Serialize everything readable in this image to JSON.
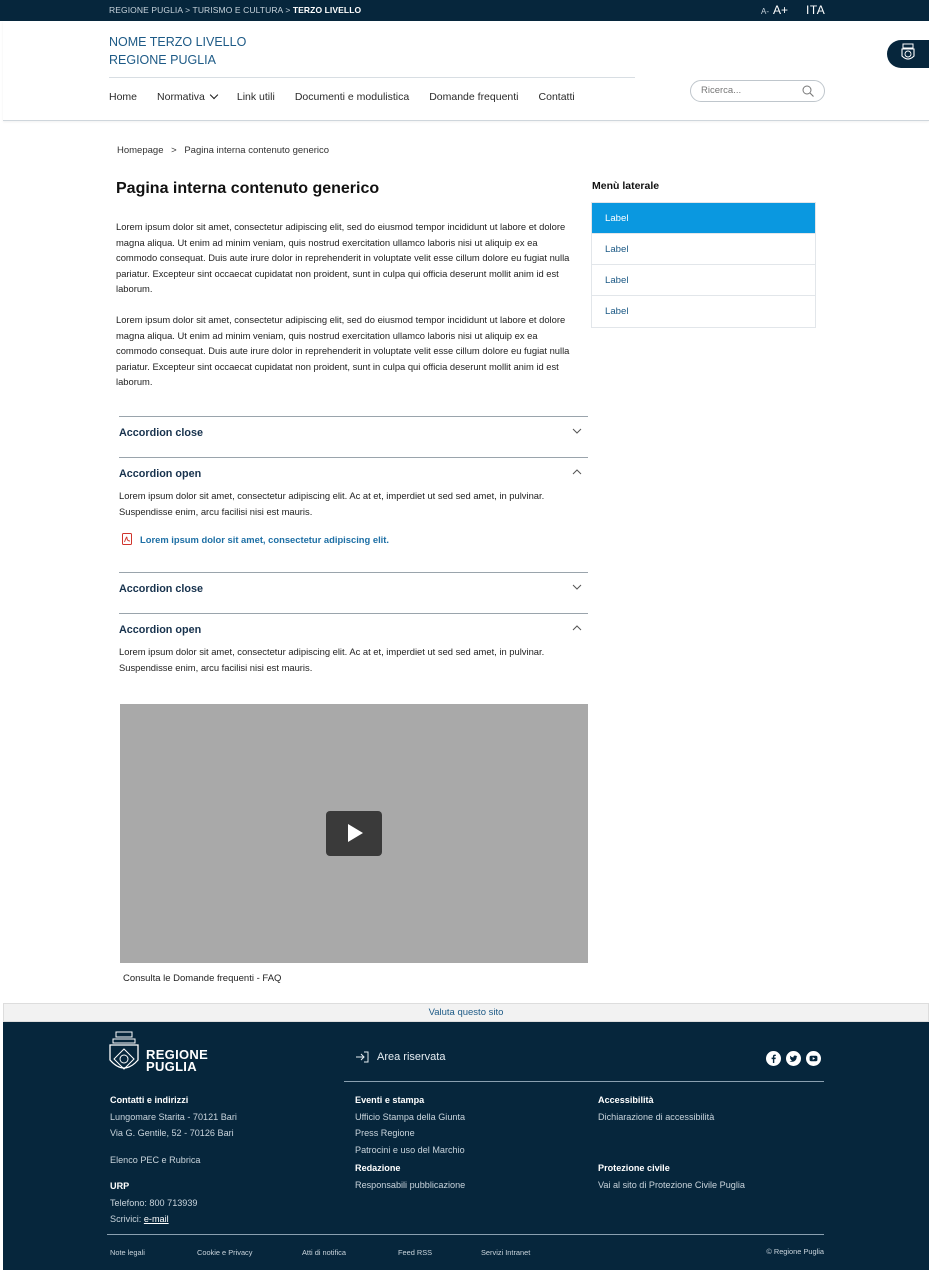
{
  "topbar": {
    "crumb_1": "REGIONE PUGLIA",
    "crumb_2": "TURISMO E CULTURA",
    "crumb_3": "TERZO LIVELLO",
    "sep": ">",
    "font_small": "A-",
    "font_big": "A+",
    "language": "ITA"
  },
  "header": {
    "site_name_line1": "NOME TERZO LIVELLO",
    "site_name_line2": "REGIONE PUGLIA",
    "nav": [
      "Home",
      "Normativa",
      "Link utili",
      "Documenti e modulistica",
      "Domande frequenti",
      "Contatti"
    ],
    "search_placeholder": "Ricerca..."
  },
  "breadcrumb": {
    "home": "Homepage",
    "sep": ">",
    "current": "Pagina interna contenuto generico"
  },
  "main": {
    "title": "Pagina interna contenuto generico",
    "paragraph_1": "Lorem ipsum dolor sit amet, consectetur adipiscing elit, sed do eiusmod tempor incididunt ut labore et dolore magna aliqua. Ut enim ad minim veniam, quis nostrud exercitation ullamco laboris nisi ut aliquip ex ea commodo consequat. Duis aute irure dolor in reprehenderit in voluptate velit esse cillum dolore eu fugiat nulla pariatur. Excepteur sint occaecat cupidatat non proident, sunt in culpa qui officia deserunt mollit anim id est laborum.",
    "paragraph_2": "Lorem ipsum dolor sit amet, consectetur adipiscing elit, sed do eiusmod tempor incididunt ut labore et dolore magna aliqua. Ut enim ad minim veniam, quis nostrud exercitation ullamco laboris nisi ut aliquip ex ea commodo consequat. Duis aute irure dolor in reprehenderit in voluptate velit esse cillum dolore eu fugiat nulla pariatur. Excepteur sint occaecat cupidatat non proident, sunt in culpa qui officia deserunt mollit anim id est laborum.",
    "accordions": [
      {
        "title": "Accordion close",
        "open": false
      },
      {
        "title": "Accordion open",
        "open": true,
        "body": "Lorem ipsum dolor sit amet, consectetur adipiscing elit. Ac at et, imperdiet ut sed sed amet, in pulvinar. Suspendisse enim, arcu facilisi nisi est mauris.",
        "link": "Lorem ipsum dolor sit amet, consectetur adipiscing elit."
      },
      {
        "title": "Accordion close",
        "open": false
      },
      {
        "title": "Accordion open",
        "open": true,
        "body": "Lorem ipsum dolor sit amet, consectetur adipiscing elit. Ac at et, imperdiet ut sed sed amet, in pulvinar. Suspendisse enim, arcu facilisi nisi est mauris."
      }
    ],
    "video_caption": "Consulta le Domande frequenti - FAQ"
  },
  "sidebar": {
    "title": "Menù laterale",
    "items": [
      "Label",
      "Label",
      "Label",
      "Label"
    ],
    "active_color": "#0a98e0"
  },
  "footer": {
    "rate": "Valuta questo sito",
    "logo_line1": "REGIONE",
    "logo_line2": "PUGLIA",
    "reserved": "Area riservata",
    "social": [
      "facebook-icon",
      "twitter-icon",
      "youtube-icon"
    ],
    "col1": {
      "heading": "Contatti e indirizzi",
      "addr1": "Lungomare Starita - 70121 Bari",
      "addr2": "Via G. Gentile, 52 - 70126 Bari",
      "pec": "Elenco PEC e Rubrica",
      "urp_heading": "URP",
      "phone": "Telefono: 800 713939",
      "write_prefix": "Scrivici:",
      "email": "e-mail"
    },
    "col2": {
      "heading": "Eventi e stampa",
      "links": [
        "Ufficio Stampa della Giunta",
        "Press Regione",
        "Patrocini e uso del Marchio"
      ],
      "heading2": "Redazione",
      "links2": [
        "Responsabili pubblicazione"
      ]
    },
    "col3": {
      "heading": "Accessibilità",
      "links": [
        "Dichiarazione di accessibilità"
      ],
      "heading2": "Protezione civile",
      "links2": [
        "Vai al sito di Protezione Civile Puglia"
      ]
    },
    "bottom": [
      "Note legali",
      "Cookie e Privacy",
      "Atti di notifica",
      "Feed RSS",
      "Servizi Intranet"
    ],
    "copyright": "© Regione Puglia",
    "bg_color": "#06263c"
  }
}
